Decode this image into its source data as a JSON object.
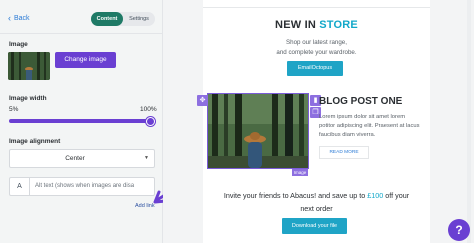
{
  "sidebar": {
    "back_label": "Back",
    "back_icon": "chevron-left-icon",
    "toggle": {
      "options": [
        "Content",
        "Settings"
      ],
      "active": "Content"
    },
    "image_label": "Image",
    "change_image_label": "Change image",
    "image_width_label": "Image width",
    "width_min": "5%",
    "width_max": "100%",
    "width_value_fraction": 1.0,
    "alignment_label": "Image alignment",
    "alignment_value": "Center",
    "alt_prefix": "A",
    "alt_placeholder": "Alt text (shows when images are disa",
    "add_link_label": "Add link"
  },
  "canvas": {
    "new_in": "NEW IN",
    "store": "STORE",
    "shop_line1": "Shop our latest range,",
    "shop_line2": "and complete your wardrobe.",
    "cta_label": "EmailOctopus",
    "blog_title": "BLOG POST ONE",
    "blog_body": "Lorem ipsum dolor sit amet lorem potitor adipiscing elit. Praesent at lacus faucibus diam viverra.",
    "read_more": "READ MORE",
    "image_tag": "Image",
    "invite_pre": "Invite your friends to Abacus! and save up to",
    "invite_amount": "£100",
    "invite_post": "off your",
    "invite_line2": "next order",
    "download_label": "Download your file",
    "help_glyph": "?"
  },
  "colors": {
    "accent_purple": "#6a3fd2",
    "teal_toggle": "#1f7a66",
    "cyan": "#12a8c9",
    "button_blue": "#1fa4c6"
  }
}
